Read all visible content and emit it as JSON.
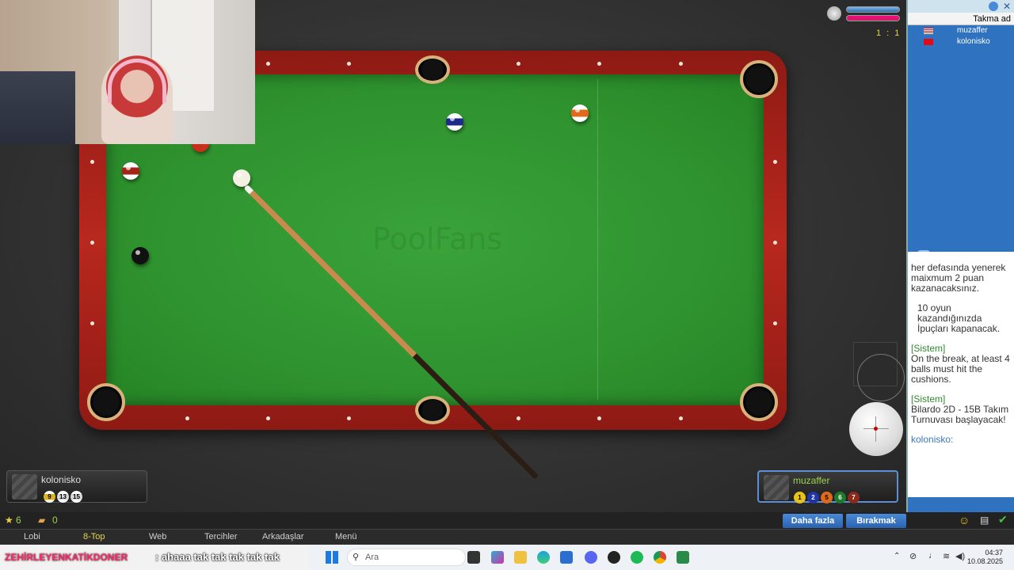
{
  "players": {
    "left": {
      "name": "kolonisko",
      "balls": [
        "9",
        "13",
        "15"
      ]
    },
    "right": {
      "name": "muzaffer",
      "balls": [
        "1",
        "2",
        "5",
        "6",
        "7"
      ]
    }
  },
  "score": "1 : 1",
  "watermark": "PoolFans",
  "sidebar": {
    "header": "Takma ad",
    "users": [
      {
        "name": "muzaffer",
        "flag": "us"
      },
      {
        "name": "kolonisko",
        "flag": "tr"
      }
    ],
    "chat": {
      "msg1": "her defasında yenerek maixmum 2 puan kazanacaksınız.",
      "msg2": "10 oyun kazandığınızda İpuçları kapanacak.",
      "sys_label": "[Sistem]",
      "msg3": "On the break, at least 4 balls must hit the cushions.",
      "msg4": "Bilardo 2D - 15B Takım Turnuvası başlayacak!",
      "self_prompt": "kolonisko:"
    }
  },
  "stats": {
    "stars": "6",
    "coins": "0"
  },
  "buttons": {
    "more": "Daha fazla",
    "leave": "Bırakmak"
  },
  "menu": [
    "Lobi",
    "8-Top",
    "Web",
    "Tercihler",
    "Arkadaşlar",
    "Menü"
  ],
  "menu_active": "8-Top",
  "ticker": {
    "name": "ZEHİRLEYENKATİKDONER",
    "message": ": ahaaa tak tak tak tak tak"
  },
  "taskbar": {
    "search_placeholder": "Ara",
    "time": "04:37",
    "date": "10.08.2025"
  },
  "colors": {
    "felt": "#2f932f",
    "rail": "#b8281e",
    "accent": "#2e72c0",
    "score": "#e8d34a"
  }
}
